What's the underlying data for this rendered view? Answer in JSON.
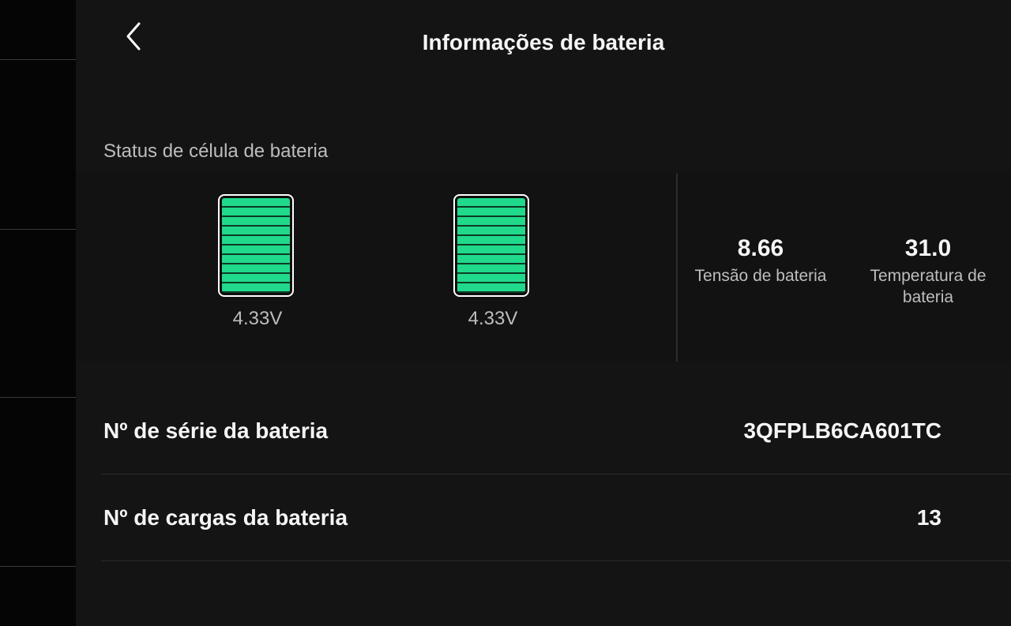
{
  "header": {
    "title": "Informações de bateria",
    "back_icon": "chevron-left-icon"
  },
  "cell_status": {
    "label": "Status de célula de bateria",
    "cells": [
      {
        "voltage": "4.33V",
        "fill_fraction": 1.0,
        "color": "#21d98a"
      },
      {
        "voltage": "4.33V",
        "fill_fraction": 1.0,
        "color": "#21d98a"
      }
    ],
    "battery_voltage": {
      "value": "8.66",
      "label": "Tensão de bateria"
    },
    "battery_temperature": {
      "value": "31.0",
      "label": "Temperatura de bateria"
    }
  },
  "details": {
    "serial": {
      "label": "Nº de série da bateria",
      "value": "3QFPLB6CA601TC"
    },
    "charges": {
      "label": "Nº de cargas da bateria",
      "value": "13"
    }
  }
}
